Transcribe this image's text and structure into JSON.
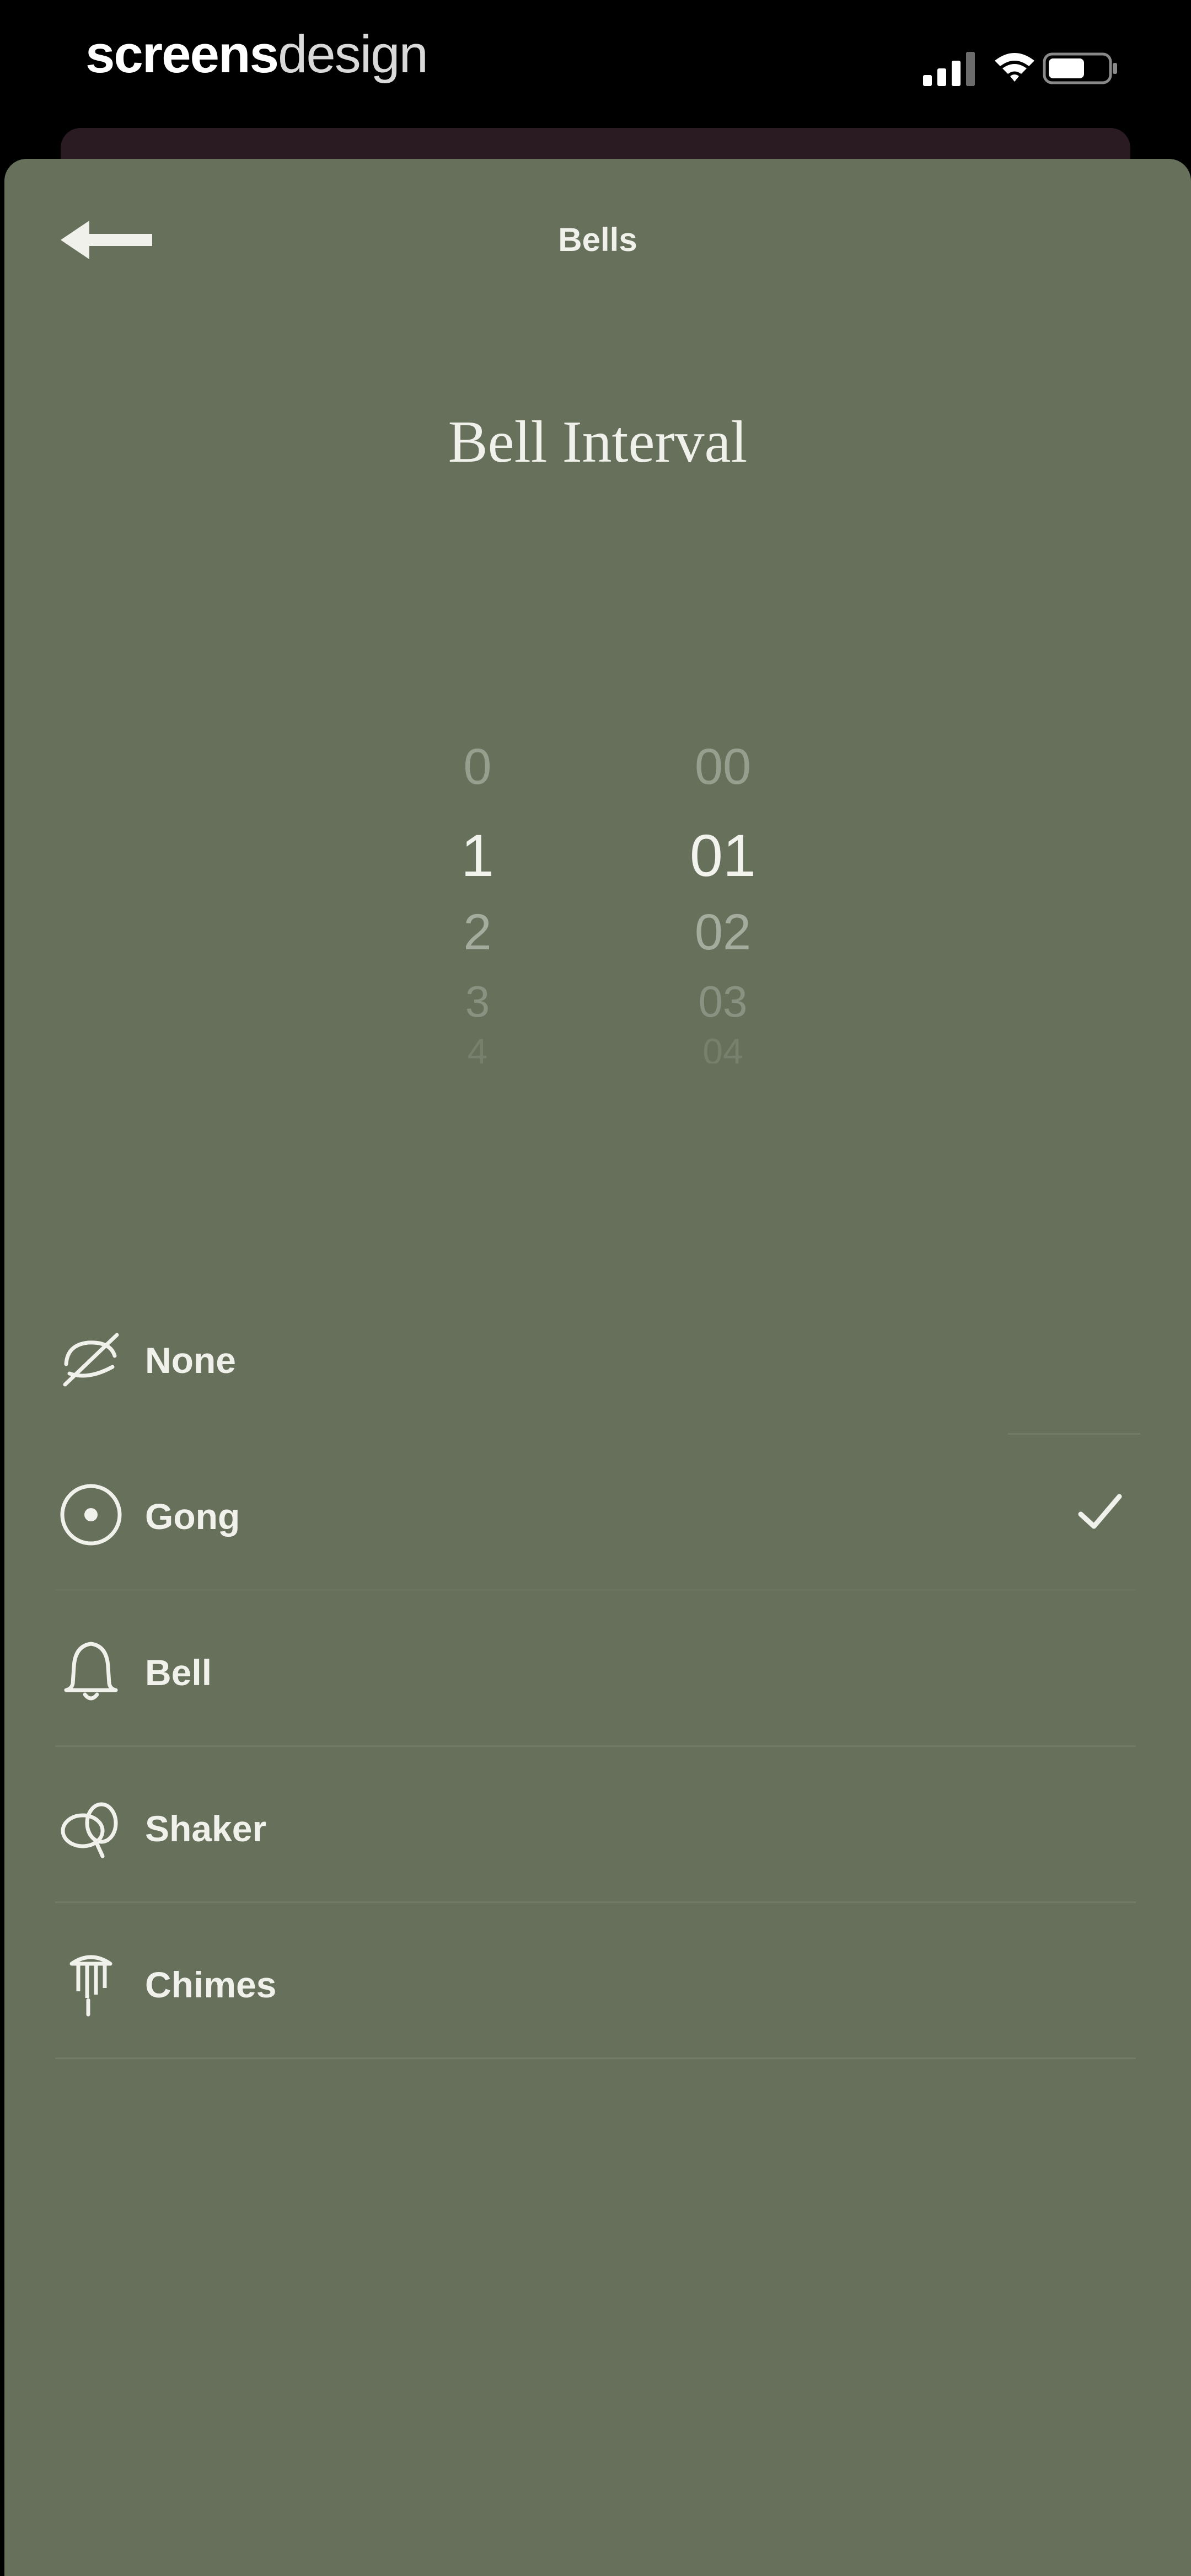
{
  "status_bar": {
    "brand_part1": "screens",
    "brand_part2": "design",
    "icons": [
      "signal-icon",
      "wifi-icon",
      "battery-icon"
    ]
  },
  "nav": {
    "back_icon": "arrow-left-icon",
    "title": "Bells"
  },
  "main": {
    "section_title": "Bell Interval",
    "picker": {
      "hours": [
        "0",
        "1",
        "2",
        "3",
        "4"
      ],
      "minutes": [
        "00",
        "01",
        "02",
        "03",
        "04"
      ],
      "selected_hours": "1",
      "selected_minutes": "01"
    }
  },
  "sounds": {
    "items": [
      {
        "label": "None",
        "icon": "no-sound-icon",
        "selected": false
      },
      {
        "label": "Gong",
        "icon": "gong-icon",
        "selected": true
      },
      {
        "label": "Bell",
        "icon": "bell-icon",
        "selected": false
      },
      {
        "label": "Shaker",
        "icon": "shaker-icon",
        "selected": false
      },
      {
        "label": "Chimes",
        "icon": "chimes-icon",
        "selected": false
      }
    ],
    "selected_icon": "checkmark-icon"
  },
  "colors": {
    "sheet_background": "#66705b",
    "text": "#f1f1ec",
    "status_bar_background": "#000000"
  }
}
